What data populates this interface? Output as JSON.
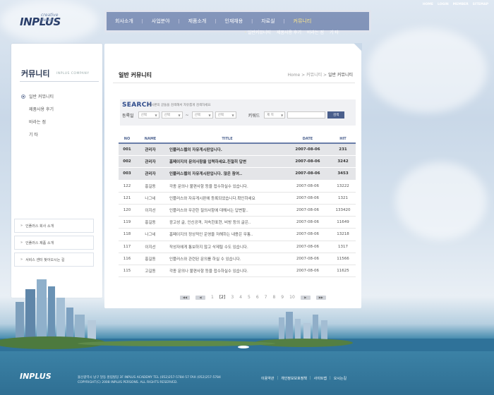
{
  "brand": {
    "logo": "INPLUS",
    "logo_sub": "creative design"
  },
  "util_links": [
    "HOME",
    "LOGIN",
    "MEMBER",
    "SITEMAP"
  ],
  "gnb": [
    "회사소개",
    "사업분야",
    "제품소개",
    "인재채용",
    "자료실",
    "커뮤니티"
  ],
  "gnb_active": 5,
  "subnav": [
    "일반커뮤니티",
    "제품사용 후기",
    "바라는 점",
    "기 타"
  ],
  "sidebar": {
    "title": "커뮤니티",
    "title_sub": "INPLUS COMPANY",
    "items": [
      "일반 커뮤니티",
      "제품사용 후기",
      "바라는 점",
      "기 타"
    ],
    "quick": [
      "인플러스 회사 소개",
      "인플러스 제품 소개",
      "서비스 센터 찾아오시는 길"
    ]
  },
  "page": {
    "title": "일반 커뮤니티",
    "breadcrumb": [
      "Home",
      "커뮤니티",
      "일반 커뮤니티"
    ]
  },
  "search": {
    "heading": "SEARCH",
    "desc": "게시판의 글들을 검색해서 자유롭게 검색하세요",
    "date_label": "등록일",
    "select_value": "선택",
    "keyword_label": "키워드",
    "keyword_select": "제 목",
    "button": "검색"
  },
  "table": {
    "headers": [
      "NO",
      "NAME",
      "TITLE",
      "DATE",
      "HIT"
    ],
    "rows": [
      {
        "no": "001",
        "name": "관리자",
        "title": "인플러스웹의 자유게시판입니다.",
        "date": "2007-08-06",
        "hit": "231",
        "notice": true
      },
      {
        "no": "002",
        "name": "관리자",
        "title": "홈페이지의 문의사항을 입력하세요.친절히 답변",
        "date": "2007-08-06",
        "hit": "3242",
        "notice": true
      },
      {
        "no": "003",
        "name": "관리자",
        "title": "인플러스웹의 자유게시판입니다. 많은 참여..",
        "date": "2007-08-06",
        "hit": "3453",
        "notice": true
      },
      {
        "no": "122",
        "name": "홍길동",
        "title": "각종 문의나 불편사항 등을 접수하실수 있습니다.",
        "date": "2007-08-06",
        "hit": "13222",
        "notice": false
      },
      {
        "no": "121",
        "name": "나그네",
        "title": "인플러스와 자유게시판에 등록되었습니다.확인하세요",
        "date": "2007-08-06",
        "hit": "1321",
        "notice": false
      },
      {
        "no": "120",
        "name": "이지선",
        "title": "인플러스와 무관한 질의사항에 대해서는 답변할..",
        "date": "2007-08-06",
        "hit": "133420",
        "notice": false
      },
      {
        "no": "119",
        "name": "홍길동",
        "title": "광고성 글, 인신공격, 저속한표현, 비방 등의 글은..",
        "date": "2007-08-06",
        "hit": "11649",
        "notice": false
      },
      {
        "no": "118",
        "name": "나그네",
        "title": "홈페이지의 정상적인 운영을 저해하는 내용은 무통..",
        "date": "2007-08-06",
        "hit": "13218",
        "notice": false
      },
      {
        "no": "117",
        "name": "이지선",
        "title": "작성자에게 통보하지 않고 삭제될 수도 있습니다.",
        "date": "2007-08-06",
        "hit": "1317",
        "notice": false
      },
      {
        "no": "116",
        "name": "홍길동",
        "title": "인플러스와 관련된 문의를 하실 수 있습니다.",
        "date": "2007-08-06",
        "hit": "11566",
        "notice": false
      },
      {
        "no": "115",
        "name": "고길동",
        "title": "각종 문의나 불편사항 등을 접수하실수 있습니다.",
        "date": "2007-08-06",
        "hit": "11625",
        "notice": false
      }
    ]
  },
  "pager": {
    "pages": [
      "1",
      "2",
      "3",
      "4",
      "5",
      "6",
      "7",
      "8",
      "9",
      "10"
    ],
    "current": "2"
  },
  "footer": {
    "logo": "INPLUS",
    "address": "울산광역시 남구 달동 원림빌딩 3F  INPLUS ACADEMY  TEL (052)257-5784-57  FAX (052)257-5784",
    "copyright": "COPYRIGHT(C) 2008 INPLUS PERSONS. ALL RIGHTS RESERVED.",
    "links": [
      "이용약관",
      "개인정보보호정책",
      "사이트맵",
      "오시는길"
    ]
  }
}
